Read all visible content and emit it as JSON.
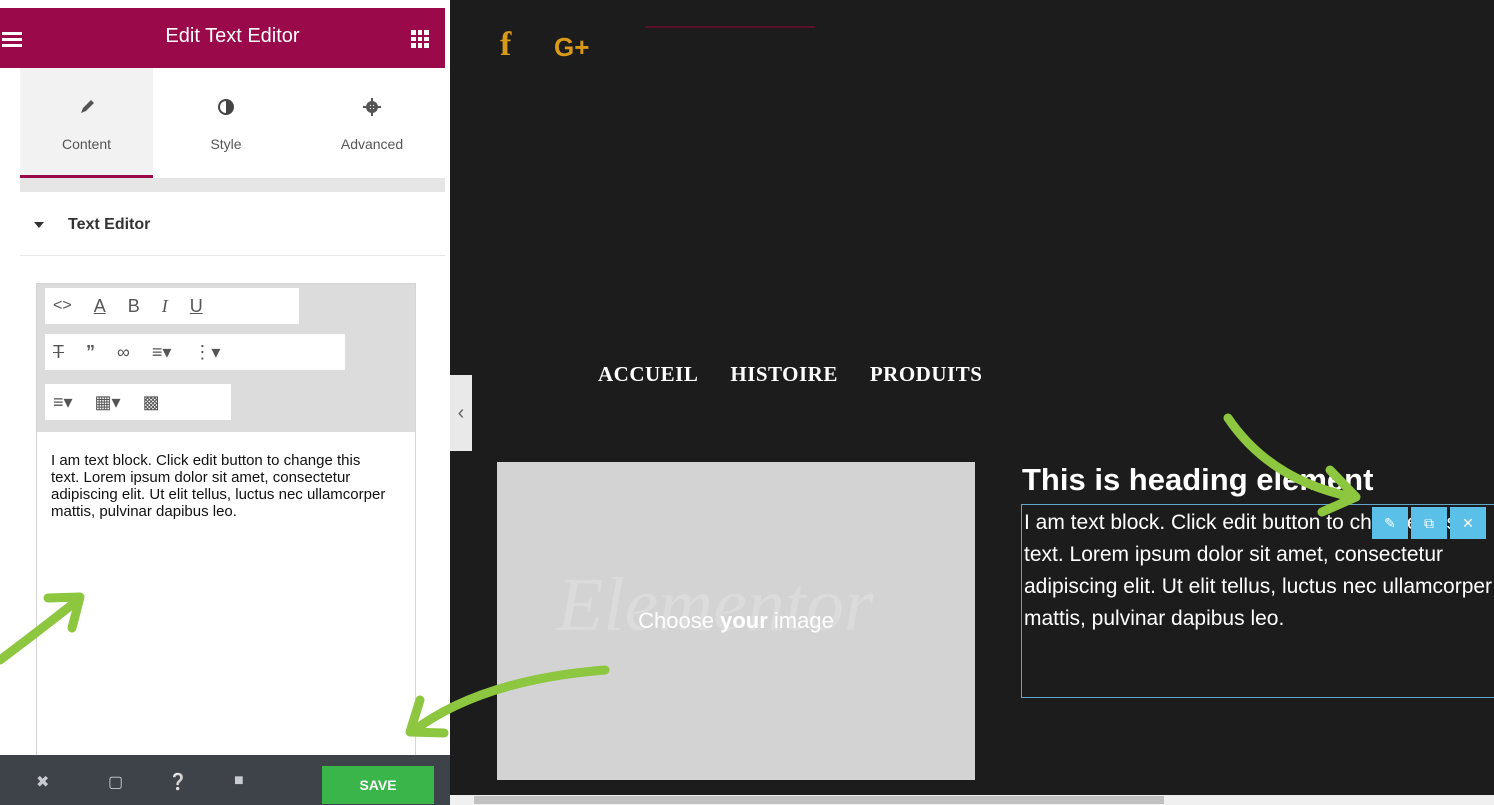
{
  "panel": {
    "title": "Edit Text Editor",
    "tabs": [
      {
        "label": "Content",
        "icon": "pencil-icon"
      },
      {
        "label": "Style",
        "icon": "half-circle-icon"
      },
      {
        "label": "Advanced",
        "icon": "gear-icon"
      }
    ],
    "section_title": "Text Editor",
    "editor_text": "I am text block. Click edit button to change this text. Lorem ipsum dolor sit amet, consectetur adipiscing elit. Ut elit tellus, luctus nec ullamcorper mattis, pulvinar dapibus leo.",
    "toolbar": {
      "row1": [
        "<>",
        "A",
        "B",
        "I",
        "U"
      ],
      "row2": [
        "strikethrough",
        "blockquote",
        "link",
        "align",
        "bullet-list"
      ],
      "row3": [
        "numbered-list",
        "table",
        "image"
      ]
    },
    "footer": {
      "save_label": "SAVE"
    }
  },
  "preview": {
    "social": [
      "f",
      "G+"
    ],
    "nav": [
      "ACCUEIL",
      "HISTOIRE",
      "PRODUITS"
    ],
    "image_placeholder": {
      "watermark": "Elementor",
      "choose": "Choose",
      "your": "your",
      "image": "image"
    },
    "heading": "This is heading element",
    "text_block": "I am text block. Click edit button to change this text. Lorem ipsum dolor sit amet, consectetur adipiscing elit. Ut elit tellus, luctus nec ullamcorper mattis, pulvinar dapibus leo."
  },
  "colors": {
    "header": "#9a0a4a",
    "save": "#39b54a",
    "social": "#d99a1a",
    "arrows": "#8dc63f",
    "widget_tools": "#5bc0e8"
  }
}
